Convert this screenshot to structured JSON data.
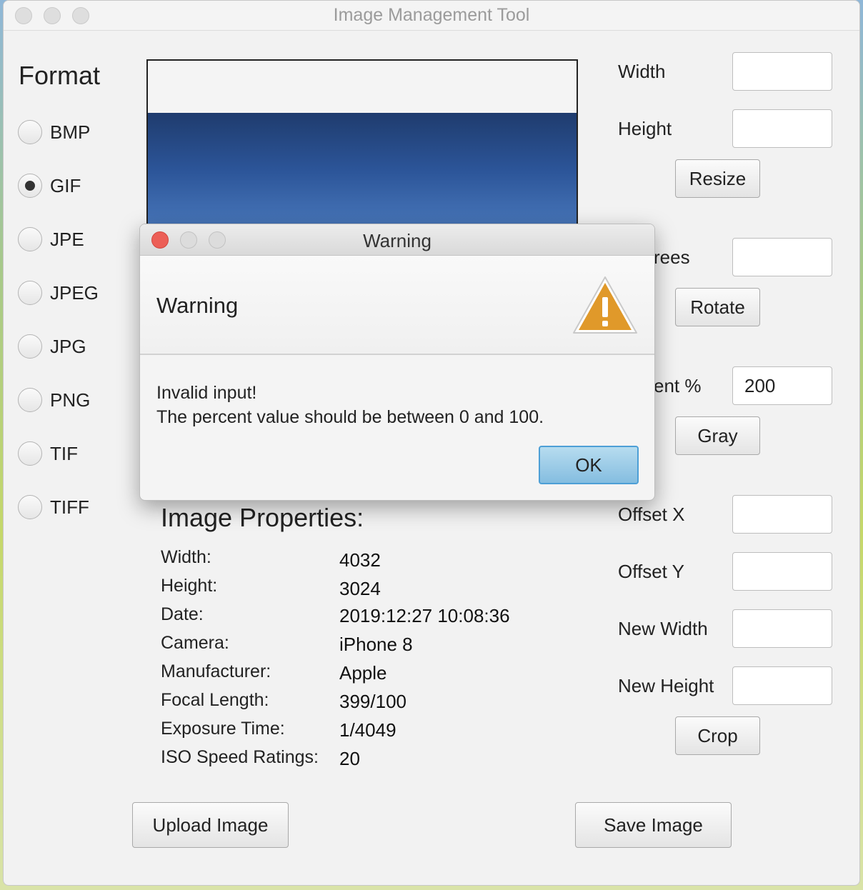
{
  "window": {
    "title": "Image Management Tool"
  },
  "format": {
    "heading": "Format",
    "options": [
      "BMP",
      "GIF",
      "JPE",
      "JPEG",
      "JPG",
      "PNG",
      "TIF",
      "TIFF"
    ],
    "selected": "GIF"
  },
  "resize": {
    "width_label": "Width",
    "height_label": "Height",
    "width_value": "",
    "height_value": "",
    "button": "Resize"
  },
  "rotate": {
    "degrees_label_visible": "rees",
    "degrees_value": "",
    "button": "Rotate"
  },
  "gray": {
    "percent_label_visible": "ent %",
    "percent_value": "200",
    "button": "Gray"
  },
  "crop": {
    "offset_x_label": "Offset X",
    "offset_y_label": "Offset Y",
    "new_width_label": "New Width",
    "new_height_label": "New Height",
    "offset_x_value": "",
    "offset_y_value": "",
    "new_width_value": "",
    "new_height_value": "",
    "button": "Crop"
  },
  "properties": {
    "title": "Image Properties:",
    "rows": [
      {
        "label": "Width:",
        "value": "4032"
      },
      {
        "label": "Height:",
        "value": "3024"
      },
      {
        "label": "Date:",
        "value": "2019:12:27 10:08:36"
      },
      {
        "label": "Camera:",
        "value": "iPhone 8"
      },
      {
        "label": "Manufacturer:",
        "value": "Apple"
      },
      {
        "label": "Focal Length:",
        "value": "399/100"
      },
      {
        "label": "Exposure Time:",
        "value": "1/4049"
      },
      {
        "label": "ISO Speed Ratings:",
        "value": "20"
      }
    ]
  },
  "actions": {
    "upload": "Upload Image",
    "save": "Save Image"
  },
  "dialog": {
    "title": "Warning",
    "header": "Warning",
    "message_line1": "Invalid input!",
    "message_line2": "The percent value should be between 0 and 100.",
    "ok": "OK",
    "icon": "warning-triangle-icon",
    "icon_color": "#e0992a"
  }
}
